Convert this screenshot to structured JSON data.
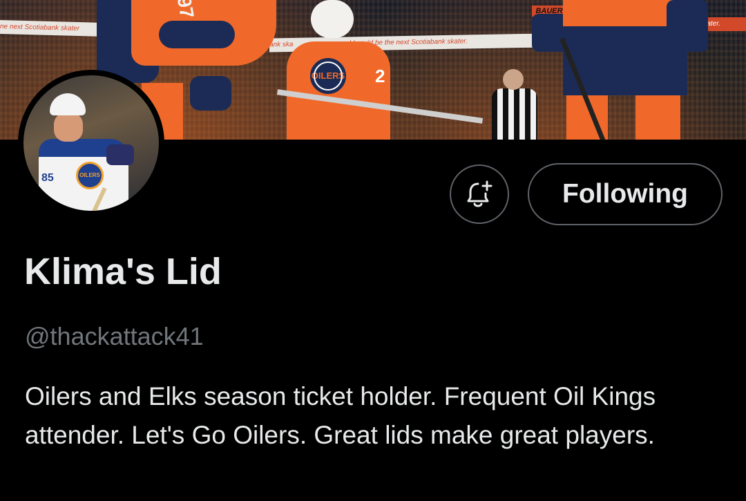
{
  "banner": {
    "ad_text_left": "ne next Scotiabank skater",
    "ad_text_center": "ank ska",
    "ad_text_center_right": "ald could be the next Scotiabank skater.",
    "ad_text_right": "nk skater.",
    "sticker_text": "BAUER",
    "crest_text": "OILERS",
    "kid_number": "2",
    "shoulder_number": "97"
  },
  "avatar": {
    "crest_text": "OILERS",
    "jersey_number": "85"
  },
  "actions": {
    "notify_icon": "bell-plus-icon",
    "following_label": "Following"
  },
  "profile": {
    "display_name": "Klima's Lid",
    "handle": "@thackattack41",
    "bio": "Oilers and Elks season ticket holder. Frequent Oil Kings attender. Let's Go Oilers. Great lids make great players."
  },
  "colors": {
    "background": "#000000",
    "text_primary": "#e7e9ea",
    "text_secondary": "#71767b",
    "border": "#5f6368",
    "oilers_orange": "#f1692a",
    "oilers_navy": "#1b2b55"
  }
}
